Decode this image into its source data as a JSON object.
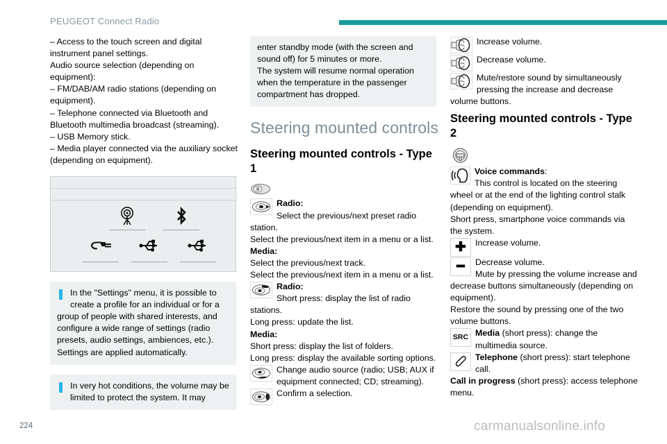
{
  "header": {
    "title": "PEUGEOT Connect Radio",
    "rule_color": "#1b9a9a"
  },
  "column1": {
    "paragraphs": [
      "–  Access to the touch screen and digital instrument panel settings.",
      "Audio source selection (depending on equipment):",
      "–  FM/DAB/AM radio stations (depending on equipment).",
      "–  Telephone connected via Bluetooth and Bluetooth multimedia broadcast (streaming).",
      "–  USB Memory stick.",
      "–  Media player connected via the auxiliary socket (depending on equipment)."
    ],
    "figure": {
      "name": "audio-source-selection-screen",
      "sources": [
        {
          "icon": "radio-antenna-icon",
          "label": ""
        },
        {
          "icon": "bluetooth-icon",
          "label": ""
        },
        {
          "icon": "aux-jack-icon",
          "label": ""
        },
        {
          "icon": "usb-icon",
          "label": ""
        },
        {
          "icon": "usb-icon",
          "label": ""
        }
      ]
    },
    "note1": "In the \"Settings\" menu, it is possible to create a profile for an individual or for a group of people with shared interests, and configure a wide range of settings (radio presets, audio settings, ambiences, etc.). Settings are applied automatically.",
    "note2": "In very hot conditions, the volume may be limited to protect the system. It may"
  },
  "column2": {
    "note_continued": "enter standby mode (with the screen and sound off) for 5 minutes or more.\nThe system will resume normal operation when the temperature in the passenger compartment has dropped.",
    "section_heading": "Steering mounted controls",
    "sub_heading": "Steering mounted controls - Type 1",
    "entries": [
      {
        "icon": "steering-control-overview-icon",
        "lines": []
      },
      {
        "icon": "rocker-up-down-button-icon",
        "bold_lead": "Radio:",
        "lines": [
          "Select the previous/next preset radio station.",
          "Select the previous/next item in a menu or a list."
        ],
        "bold_lead2": "Media:",
        "lines2": [
          "Select the previous/next track.",
          "Select the previous/next item in a menu or a list."
        ]
      },
      {
        "icon": "list-button-icon",
        "bold_lead": "Radio:",
        "lines": [
          "Short press: display the list of radio stations.",
          "Long press: update the list."
        ],
        "bold_lead2": "Media:",
        "lines2": [
          "Short press: display the list of folders.",
          "Long press: display the available sorting options."
        ]
      },
      {
        "icon": "source-button-icon",
        "lines": [
          "Change audio source (radio; USB; AUX if equipment connected; CD; streaming)."
        ]
      },
      {
        "icon": "confirm-button-icon",
        "lines": [
          "Confirm a selection."
        ]
      }
    ]
  },
  "column3": {
    "type1_entries": [
      {
        "icon": "volume-wheel-up-icon",
        "text": "Increase volume."
      },
      {
        "icon": "volume-wheel-down-icon",
        "text": "Decrease volume."
      },
      {
        "icon": "volume-wheel-mute-icon",
        "text": "Mute/restore sound by simultaneously pressing the increase and decrease volume buttons."
      }
    ],
    "sub_heading": "Steering mounted controls - Type 2",
    "steering_wheel_icon": "steering-wheel-icon",
    "voice": {
      "icon": "voice-command-icon",
      "bold_lead": "Voice commands",
      "bold_lead_suffix": ":",
      "text": "This control is located on the steering wheel or at the end of the lighting control stalk (depending on equipment).",
      "text2": "Short press, smartphone voice commands via the system."
    },
    "plus": {
      "icon": "plus-button-icon",
      "glyph": "✚",
      "text": "Increase volume."
    },
    "minus": {
      "icon": "minus-button-icon",
      "glyph": "━",
      "text": "Decrease volume.",
      "text2": "Mute by pressing the volume increase and decrease buttons simultaneously (depending on equipment).",
      "text3": "Restore the sound by pressing one of the two volume buttons."
    },
    "src": {
      "icon": "src-button-icon",
      "glyph": "SRC",
      "bold_lead": "Media",
      "text": " (short press): change the multimedia source."
    },
    "phone": {
      "icon": "telephone-button-icon",
      "bold_lead": "Telephone",
      "text": " (short press): start telephone call."
    },
    "call_in_progress": {
      "bold_lead": "Call in progress",
      "text": " (short press): access telephone menu."
    }
  },
  "footer": {
    "page_number": "224",
    "watermark": "carmanualsonline.info"
  }
}
